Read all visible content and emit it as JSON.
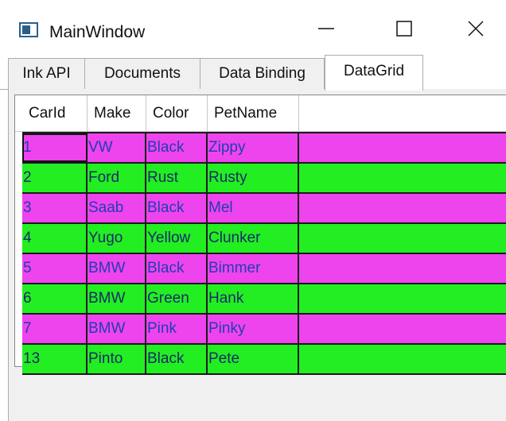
{
  "window": {
    "title": "MainWindow",
    "minimize_glyph": "—",
    "maximize_glyph": "☐",
    "close_glyph": "✕"
  },
  "tabs": [
    {
      "label": "Ink API"
    },
    {
      "label": "Documents"
    },
    {
      "label": "Data Binding"
    },
    {
      "label": "DataGrid",
      "selected": true
    }
  ],
  "grid": {
    "columns": [
      "CarId",
      "Make",
      "Color",
      "PetName"
    ],
    "rows": [
      [
        "1",
        "VW",
        "Black",
        "Zippy"
      ],
      [
        "2",
        "Ford",
        "Rust",
        "Rusty"
      ],
      [
        "3",
        "Saab",
        "Black",
        "Mel"
      ],
      [
        "4",
        "Yugo",
        "Yellow",
        "Clunker"
      ],
      [
        "5",
        "BMW",
        "Black",
        "Bimmer"
      ],
      [
        "6",
        "BMW",
        "Green",
        "Hank"
      ],
      [
        "7",
        "BMW",
        "Pink",
        "Pinky"
      ],
      [
        "13",
        "Pinto",
        "Black",
        "Pete"
      ]
    ]
  },
  "colors": {
    "odd_row": "#ee44ee",
    "even_row": "#22ee22",
    "accent_icon": "#2b5f8a"
  }
}
